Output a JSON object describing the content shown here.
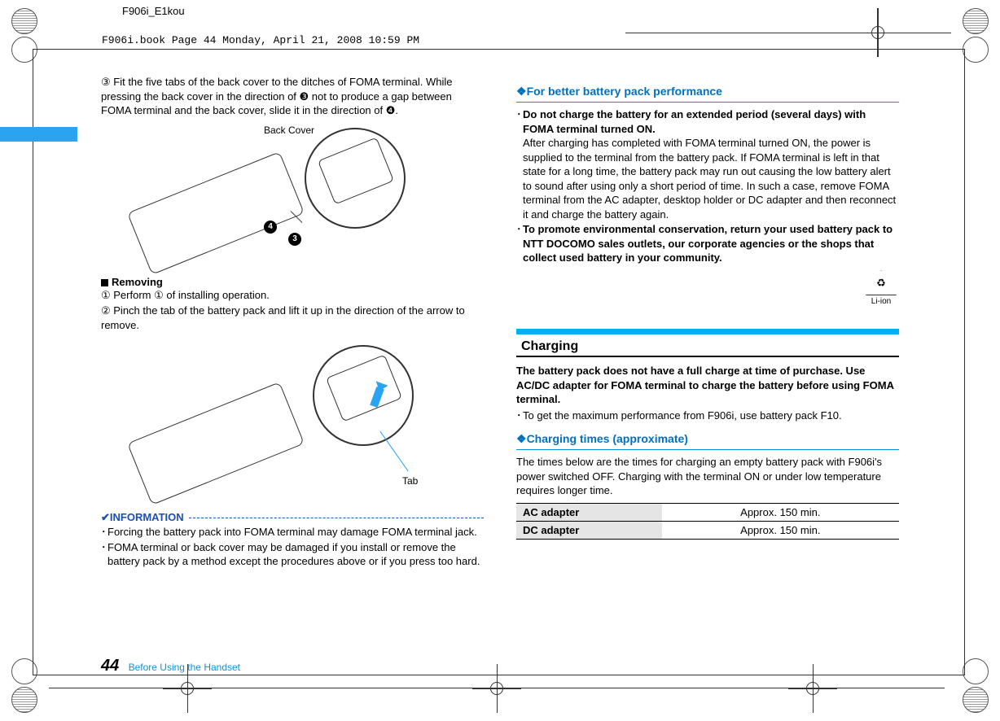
{
  "meta": {
    "doc_label": "F906i_E1kou",
    "book_info": "F906i.book  Page 44  Monday, April 21, 2008  10:59 PM"
  },
  "left": {
    "step3": "③ Fit the five tabs of the back cover to the ditches of FOMA terminal. While pressing the back cover in the direction of ❸ not to produce a gap between FOMA terminal and the back cover, slide it in the direction of ❹.",
    "fig1_label": "Back Cover",
    "fig1_badge3": "3",
    "fig1_badge4": "4",
    "removing_head": "Removing",
    "rem1": "① Perform ① of installing operation.",
    "rem2": "② Pinch the tab of the battery pack and lift it up in the direction of the arrow to remove.",
    "fig2_label": "Tab",
    "info_title": "✔INFORMATION",
    "info1": "Forcing the battery pack into FOMA terminal may damage FOMA terminal jack.",
    "info2": "FOMA terminal or back cover may be damaged if you install or remove the battery pack by a method except the procedures above or if you press too hard."
  },
  "right": {
    "sec1_title": "For better battery pack performance",
    "b1_head": "Do not charge the battery for an extended period (several days) with FOMA terminal turned ON.",
    "b1_body": "After charging has completed with FOMA terminal turned ON, the power is supplied to the terminal from the battery pack. If FOMA terminal is left in that state for a long time, the battery pack may run out causing the low battery alert to sound after using only a short period of time. In such a case, remove FOMA terminal from the AC adapter, desktop holder or DC adapter and then reconnect it and charge the battery again.",
    "b2_head": "To promote environmental conservation, return your used battery pack to NTT DOCOMO sales outlets, our corporate agencies or the shops that collect used battery in your community.",
    "li_ion": "Li-ion",
    "charging_title": "Charging",
    "charging_intro": "The battery pack does not have a full charge at time of purchase. Use AC/DC adapter for FOMA terminal to charge the battery before using FOMA terminal.",
    "charging_note": "To get the maximum performance from F906i, use battery pack F10.",
    "sec2_title": "Charging times (approximate)",
    "sec2_body": "The times below are the times for charging an empty battery pack with F906i's power switched OFF. Charging with the terminal ON or under low temperature requires longer time.",
    "table": {
      "r1h": "AC adapter",
      "r1v": "Approx. 150 min.",
      "r2h": "DC adapter",
      "r2v": "Approx. 150 min."
    }
  },
  "footer": {
    "page": "44",
    "section": "Before Using the Handset"
  }
}
